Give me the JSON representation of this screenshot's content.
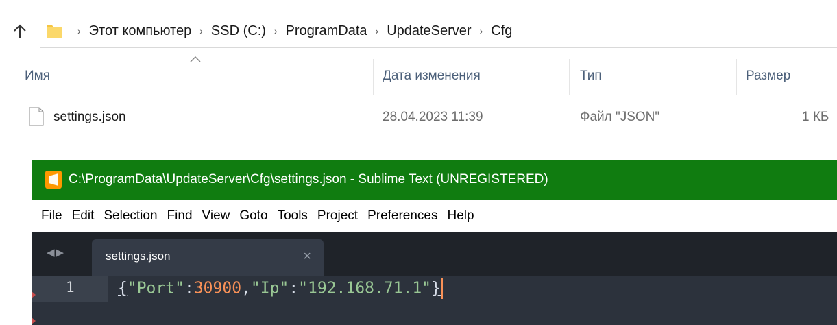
{
  "explorer": {
    "breadcrumbs": [
      "Этот компьютер",
      "SSD (C:)",
      "ProgramData",
      "UpdateServer",
      "Cfg"
    ],
    "columns": {
      "name": "Имя",
      "date": "Дата изменения",
      "type": "Тип",
      "size": "Размер"
    },
    "files": [
      {
        "name": "settings.json",
        "date": "28.04.2023 11:39",
        "type": "Файл \"JSON\"",
        "size": "1 КБ"
      }
    ]
  },
  "sublime": {
    "title": "C:\\ProgramData\\UpdateServer\\Cfg\\settings.json - Sublime Text (UNREGISTERED)",
    "menu": [
      "File",
      "Edit",
      "Selection",
      "Find",
      "View",
      "Goto",
      "Tools",
      "Project",
      "Preferences",
      "Help"
    ],
    "tab_label": "settings.json",
    "line_number": "1",
    "code_tokens": {
      "open": "{",
      "key1": "\"Port\"",
      "colon1": ":",
      "val1": "30900",
      "comma": ",",
      "key2": "\"Ip\"",
      "colon2": ":",
      "val2": "\"192.168.71.1\"",
      "close": "}"
    },
    "colors": {
      "titlebar": "#107c10",
      "editor_bg": "#2c323c",
      "string": "#99c794",
      "number": "#f99157"
    }
  }
}
